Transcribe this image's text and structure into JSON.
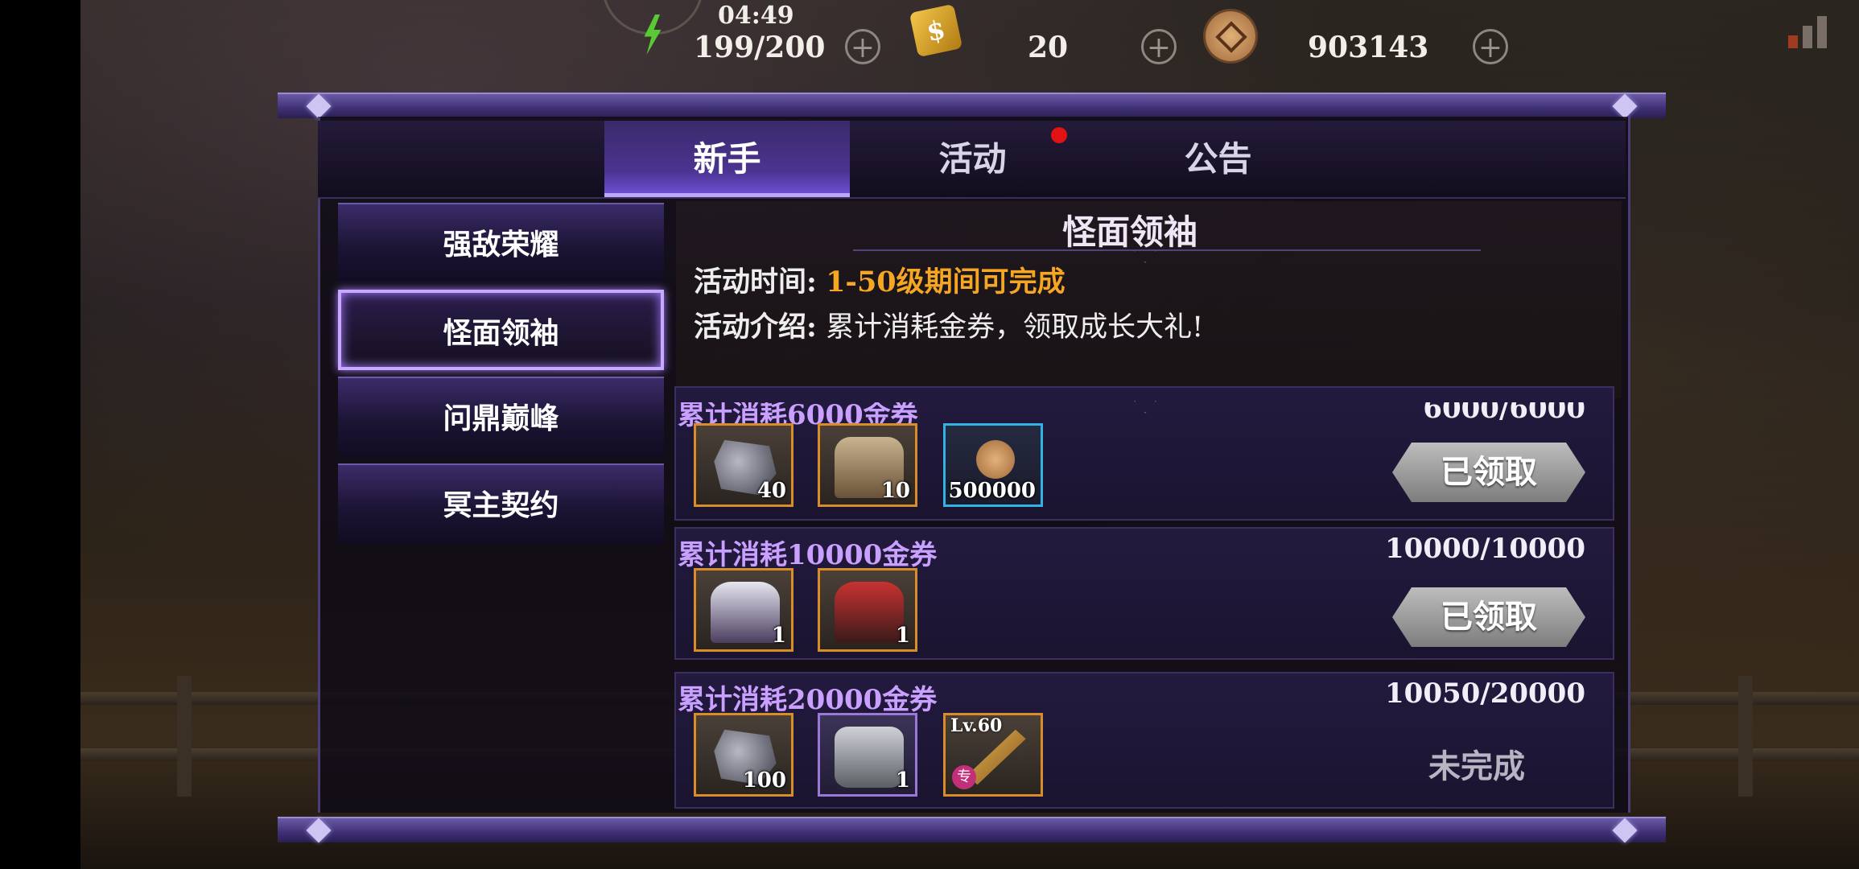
{
  "hud": {
    "timer": "04:49",
    "energy": "199/200",
    "tickets": "20",
    "gold": "903143"
  },
  "tabs": [
    {
      "label": "新手",
      "active": true
    },
    {
      "label": "活动",
      "active": false,
      "has_notification": true
    },
    {
      "label": "公告",
      "active": false
    }
  ],
  "menu": [
    {
      "label": "强敌荣耀",
      "active": false
    },
    {
      "label": "怪面领袖",
      "active": true
    },
    {
      "label": "问鼎巅峰",
      "active": false
    },
    {
      "label": "冥主契约",
      "active": false
    }
  ],
  "content": {
    "title": "怪面领袖",
    "time_label": "活动时间:",
    "time_value": "1-50级期间可完成",
    "intro_label": "活动介绍:",
    "intro_value": "累计消耗金券，领取成长大礼!"
  },
  "rows": [
    {
      "title": "累计消耗6000金券",
      "progress": "6000/6000",
      "rewards": [
        {
          "icon": "stone-icon",
          "qty": "40"
        },
        {
          "icon": "chest-icon",
          "qty": "10"
        },
        {
          "icon": "gold-coin-icon",
          "qty": "500000"
        }
      ],
      "status": "已领取"
    },
    {
      "title": "累计消耗10000金券",
      "progress": "10000/10000",
      "rewards": [
        {
          "icon": "hero-white-hair-icon",
          "qty": "1"
        },
        {
          "icon": "hero-red-icon",
          "qty": "1"
        }
      ],
      "status": "已领取"
    },
    {
      "title": "累计消耗20000金券",
      "progress": "10050/20000",
      "rewards": [
        {
          "icon": "stone-icon",
          "qty": "100"
        },
        {
          "icon": "mech-hero-icon",
          "qty": "1"
        },
        {
          "icon": "weapon-icon",
          "level": "Lv.60",
          "badge": "专"
        }
      ],
      "status": "未完成"
    }
  ]
}
